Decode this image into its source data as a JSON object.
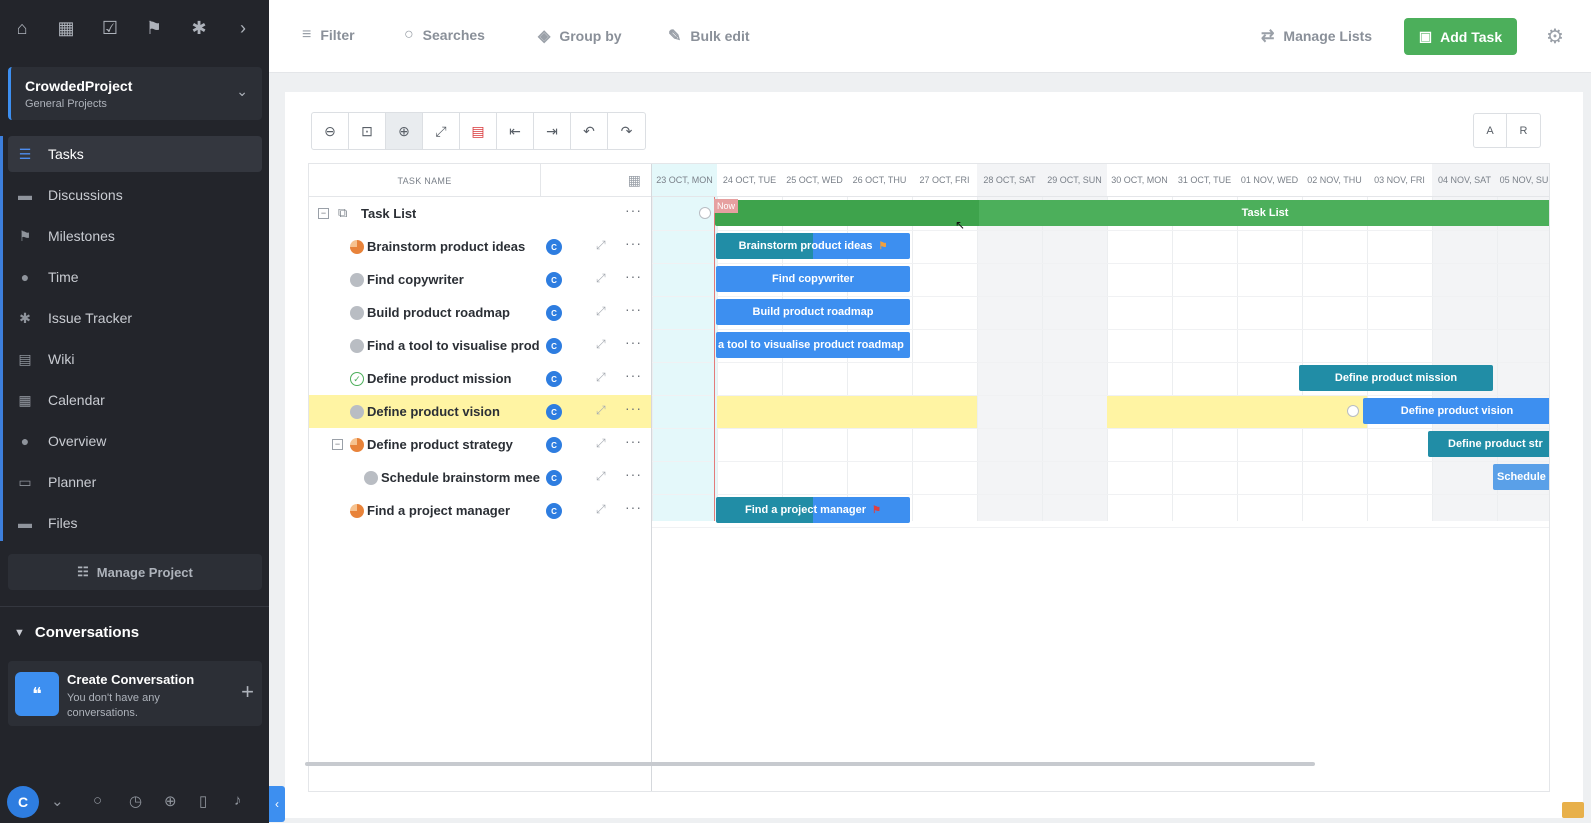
{
  "sidebar": {
    "top_icons": [
      "home-icon",
      "grid-icon",
      "tasks-icon",
      "flag-icon",
      "bug-icon",
      "chevron-right-icon"
    ],
    "project": {
      "name": "CrowdedProject",
      "category": "General Projects"
    },
    "nav": [
      {
        "label": "Tasks",
        "icon": "tasks-icon"
      },
      {
        "label": "Discussions",
        "icon": "chat-icon"
      },
      {
        "label": "Milestones",
        "icon": "flag-icon"
      },
      {
        "label": "Time",
        "icon": "clock-icon"
      },
      {
        "label": "Issue Tracker",
        "icon": "bug-icon"
      },
      {
        "label": "Wiki",
        "icon": "book-icon"
      },
      {
        "label": "Calendar",
        "icon": "calendar-icon"
      },
      {
        "label": "Overview",
        "icon": "info-icon"
      },
      {
        "label": "Planner",
        "icon": "planner-icon"
      },
      {
        "label": "Files",
        "icon": "folder-icon"
      }
    ],
    "manage_project": "Manage Project",
    "conversations": {
      "header": "Conversations",
      "create_title": "Create Conversation",
      "empty_text": "You don't have any conversations."
    },
    "avatar_initial": "C"
  },
  "toolbar": {
    "filter": "Filter",
    "searches": "Searches",
    "group_by": "Group by",
    "bulk_edit": "Bulk edit",
    "manage_lists": "Manage Lists",
    "add_task": "Add Task"
  },
  "gantt": {
    "az_buttons": [
      "A",
      "R"
    ],
    "column_header": "TASK NAME",
    "now_label": "Now",
    "days": [
      "23 OCT, MON",
      "24 OCT, TUE",
      "25 OCT, WED",
      "26 OCT, THU",
      "27 OCT, FRI",
      "28 OCT, SAT",
      "29 OCT, SUN",
      "30 OCT, MON",
      "31 OCT, TUE",
      "01 NOV, WED",
      "02 NOV, THU",
      "03 NOV, FRI",
      "04 NOV, SAT",
      "05 NOV, SU"
    ],
    "list_name": "Task List",
    "tasks": [
      {
        "name": "Brainstorm product ideas",
        "status": "in-progress",
        "assignee": "C",
        "bar_label": "Brainstorm product ideas"
      },
      {
        "name": "Find copywriter",
        "status": "not-started",
        "assignee": "C",
        "bar_label": "Find copywriter"
      },
      {
        "name": "Build product roadmap",
        "status": "not-started",
        "assignee": "C",
        "bar_label": "Build product roadmap"
      },
      {
        "name": "Find a tool to visualise prod",
        "status": "not-started",
        "assignee": "C",
        "bar_label": "a tool to visualise product roadmap"
      },
      {
        "name": "Define product mission",
        "status": "done",
        "assignee": "C",
        "bar_label": "Define product mission"
      },
      {
        "name": "Define product vision",
        "status": "not-started",
        "assignee": "C",
        "bar_label": "Define product vision"
      },
      {
        "name": "Define product strategy",
        "status": "in-progress",
        "assignee": "C",
        "bar_label": "Define product str"
      },
      {
        "name": "Schedule brainstorm mee",
        "status": "not-started",
        "assignee": "C",
        "bar_label": "Schedule"
      },
      {
        "name": "Find a project manager",
        "status": "in-progress",
        "assignee": "C",
        "bar_label": "Find a project manager"
      }
    ]
  },
  "colors": {
    "accent": "#3d8ff0",
    "add_task": "#4caf5b",
    "highlight_row": "#fff4a3",
    "list_bar": "#4caf5b"
  }
}
